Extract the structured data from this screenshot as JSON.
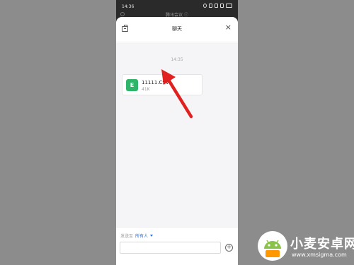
{
  "statusbar": {
    "time": "14:36"
  },
  "background": {
    "meeting_title": "腾讯会议 ⓘ"
  },
  "header": {
    "title": "聊天",
    "close": "×"
  },
  "chat": {
    "timestamp": "14:35",
    "sender": "",
    "file": {
      "icon_letter": "E",
      "name": "11111.CSV",
      "size": "41K",
      "icon_color": "#2fb56a"
    }
  },
  "footer": {
    "send_to_label": "发送至",
    "recipient": "所有人",
    "input_placeholder": "",
    "plus": "+"
  },
  "annotation": {
    "arrow_color": "#e0211f"
  },
  "watermark": {
    "title": "小麦安卓网",
    "url": "www.xmsigma.com"
  }
}
